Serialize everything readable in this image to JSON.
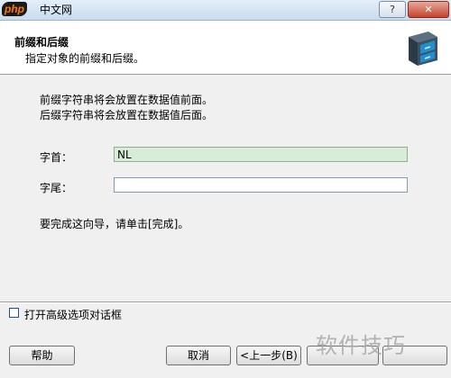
{
  "window": {
    "logo_text": "php",
    "title": "中文网",
    "help_button": "?",
    "close_button": "✕"
  },
  "header": {
    "title": "前缀和后缀",
    "subtitle": "指定对象的前缀和后缀。"
  },
  "description": {
    "line1": "前缀字符串将会放置在数据值前面。",
    "line2": "后缀字符串将会放置在数据值后面。"
  },
  "fields": {
    "prefix_label": "字首：",
    "prefix_value": "NL",
    "suffix_label": "字尾：",
    "suffix_value": ""
  },
  "finish_note": "要完成这向导，请单击[完成]。",
  "advanced": {
    "label": "打开高级选项对话框",
    "checked": false
  },
  "buttons": {
    "help": "帮助",
    "cancel": "取消",
    "back": "<上一步(B)",
    "next": "",
    "finish": ""
  },
  "watermark": "软件技巧",
  "colors": {
    "prefix_field_bg": "#d8ecd8",
    "header_bg": "#ffffff",
    "dialog_bg": "#f0f0f0"
  },
  "icons": {
    "header": "file-cabinet-icon"
  }
}
